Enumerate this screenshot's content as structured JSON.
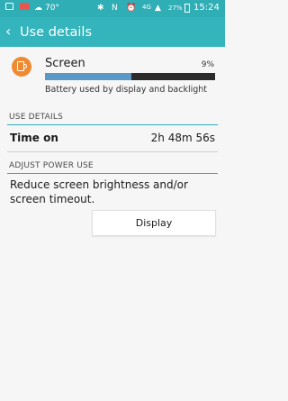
{
  "status_bar": {
    "temperature": "70°",
    "network": "4G",
    "battery_percent": "27%",
    "time": "15:24"
  },
  "app_bar": {
    "title": "Use details"
  },
  "usage_item": {
    "name": "Screen",
    "percent_label": "9%",
    "percent_value": 0.51,
    "description": "Battery used by display and backlight",
    "bar_color": "#5a98c6",
    "icon_color": "#ee8a32"
  },
  "use_details": {
    "header": "USE DETAILS",
    "time_on_label": "Time on",
    "time_on_value": "2h 48m 56s"
  },
  "adjust_power": {
    "header": "ADJUST POWER USE",
    "text": "Reduce screen brightness and/or screen timeout.",
    "button_label": "Display"
  },
  "colors": {
    "accent": "#34b4bc",
    "status_bar": "#2faeb6"
  }
}
